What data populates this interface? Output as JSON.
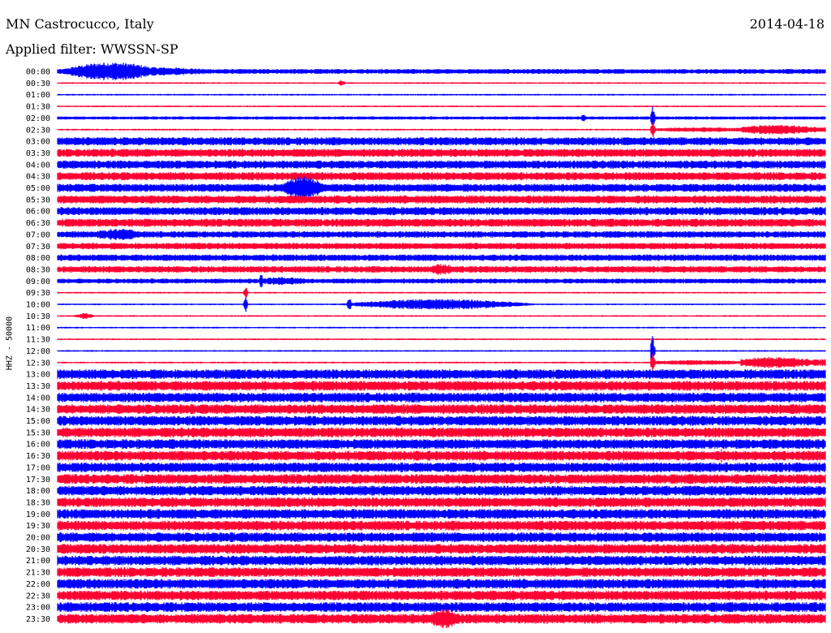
{
  "header": {
    "station": "MN Castrocucco, Italy",
    "date": "2014-04-18",
    "filter": "Applied filter: WWSSN-SP"
  },
  "chart_data": {
    "type": "line",
    "title": "MN Castrocucco, Italy",
    "date": "2014-04-18",
    "filter": "WWSSN-SP",
    "ylabel": "HHZ - 50000",
    "row_labels": [
      "00:00",
      "00:30",
      "01:00",
      "01:30",
      "02:00",
      "02:30",
      "03:00",
      "03:30",
      "04:00",
      "04:30",
      "05:00",
      "05:30",
      "06:00",
      "06:30",
      "07:00",
      "07:30",
      "08:00",
      "08:30",
      "09:00",
      "09:30",
      "10:00",
      "10:30",
      "11:00",
      "11:30",
      "12:00",
      "12:30",
      "13:00",
      "13:30",
      "14:00",
      "14:30",
      "15:00",
      "15:30",
      "16:00",
      "16:30",
      "17:00",
      "17:30",
      "18:00",
      "18:30",
      "19:00",
      "19:30",
      "20:00",
      "20:30",
      "21:00",
      "21:30",
      "22:00",
      "22:30",
      "23:00",
      "23:30"
    ],
    "colors": [
      "#0000ff",
      "#ff0033"
    ],
    "noise_level": [
      3,
      1,
      1,
      1,
      2,
      1,
      5,
      5,
      5,
      5,
      5,
      5,
      5,
      5,
      4,
      4,
      4,
      4,
      3,
      1,
      1,
      1,
      1,
      1,
      1,
      1,
      6,
      6,
      6,
      6,
      6,
      6,
      6,
      6,
      6,
      6,
      6,
      6,
      6,
      6,
      6,
      6,
      6,
      6,
      6,
      6,
      6,
      6
    ],
    "events": [
      {
        "row": 0,
        "pos": 0.0,
        "width": 0.14,
        "amp": 10,
        "shape": "burst"
      },
      {
        "row": 0,
        "pos": 0.0,
        "width": 0.22,
        "amp": 4,
        "shape": "burst"
      },
      {
        "row": 1,
        "pos": 0.365,
        "width": 0.01,
        "amp": 3,
        "shape": "burst"
      },
      {
        "row": 4,
        "pos": 0.68,
        "width": 0.01,
        "amp": 3,
        "shape": "burst"
      },
      {
        "row": 4,
        "pos": 0.77,
        "width": 0.01,
        "amp": 18,
        "shape": "spike"
      },
      {
        "row": 5,
        "pos": 0.77,
        "width": 0.01,
        "amp": 12,
        "shape": "spike"
      },
      {
        "row": 5,
        "pos": 0.775,
        "width": 0.16,
        "amp": 3,
        "shape": "coda"
      },
      {
        "row": 5,
        "pos": 0.89,
        "width": 0.11,
        "amp": 6,
        "shape": "coda"
      },
      {
        "row": 10,
        "pos": 0.29,
        "width": 0.06,
        "amp": 12,
        "shape": "burst"
      },
      {
        "row": 14,
        "pos": 0.04,
        "width": 0.08,
        "amp": 5,
        "shape": "burst"
      },
      {
        "row": 17,
        "pos": 0.48,
        "width": 0.04,
        "amp": 5,
        "shape": "burst"
      },
      {
        "row": 18,
        "pos": 0.26,
        "width": 0.01,
        "amp": 11,
        "shape": "spike"
      },
      {
        "row": 18,
        "pos": 0.26,
        "width": 0.08,
        "amp": 5,
        "shape": "coda"
      },
      {
        "row": 19,
        "pos": 0.24,
        "width": 0.01,
        "amp": 8,
        "shape": "spike"
      },
      {
        "row": 20,
        "pos": 0.24,
        "width": 0.01,
        "amp": 10,
        "shape": "spike"
      },
      {
        "row": 20,
        "pos": 0.36,
        "width": 0.27,
        "amp": 6,
        "shape": "burst"
      },
      {
        "row": 20,
        "pos": 0.37,
        "width": 0.02,
        "amp": 9,
        "shape": "spike"
      },
      {
        "row": 21,
        "pos": 0.02,
        "width": 0.03,
        "amp": 3,
        "shape": "burst"
      },
      {
        "row": 24,
        "pos": 0.77,
        "width": 0.01,
        "amp": 20,
        "shape": "spike"
      },
      {
        "row": 25,
        "pos": 0.77,
        "width": 0.01,
        "amp": 12,
        "shape": "spike"
      },
      {
        "row": 25,
        "pos": 0.775,
        "width": 0.14,
        "amp": 3,
        "shape": "coda"
      },
      {
        "row": 25,
        "pos": 0.89,
        "width": 0.11,
        "amp": 7,
        "shape": "coda"
      },
      {
        "row": 33,
        "pos": 0.86,
        "width": 0.01,
        "amp": 10,
        "shape": "spike"
      },
      {
        "row": 47,
        "pos": 0.48,
        "width": 0.05,
        "amp": 9,
        "shape": "burst"
      }
    ]
  }
}
